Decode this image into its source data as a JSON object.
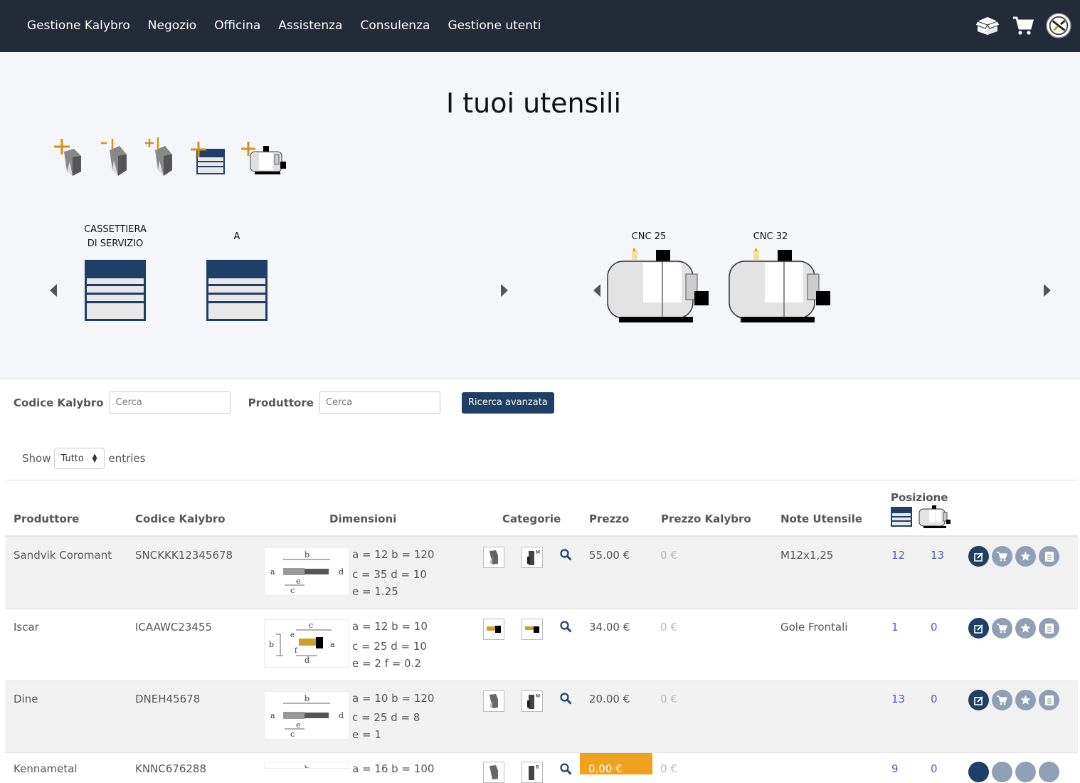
{
  "nav": {
    "links": [
      "Gestione Kalybro",
      "Negozio",
      "Officina",
      "Assistenza",
      "Consulenza",
      "Gestione utenti"
    ],
    "icons": [
      "open-box-icon",
      "cart-icon",
      "user-avatar-icon"
    ]
  },
  "page": {
    "title": "I tuoi utensili"
  },
  "tool_actions": [
    "add-tool-icon",
    "minus-one-tool-icon",
    "plus-one-tool-icon",
    "add-drawer-icon",
    "add-machine-icon"
  ],
  "stores": [
    {
      "label_line1": "CASSETTIERA",
      "label_line2": "DI SERVIZIO",
      "type": "drawer"
    },
    {
      "label_line1": "A",
      "label_line2": "",
      "type": "drawer"
    }
  ],
  "machines": [
    {
      "label": "CNC 25"
    },
    {
      "label": "CNC 32"
    }
  ],
  "filters": {
    "codice_label": "Codice Kalybro",
    "codice_placeholder": "Cerca",
    "produttore_label": "Produttore",
    "produttore_placeholder": "Cerca",
    "advanced_button": "Ricerca avanzata"
  },
  "entries": {
    "show": "Show",
    "value": "Tutto",
    "suffix": "entries"
  },
  "table": {
    "headers": {
      "produttore": "Produttore",
      "codice": "Codice Kalybro",
      "dimensioni": "Dimensioni",
      "categorie": "Categorie",
      "prezzo": "Prezzo",
      "prezzo_kalybro": "Prezzo Kalybro",
      "note": "Note Utensile",
      "posizione": "Posizione"
    },
    "rows": [
      {
        "produttore": "Sandvik Coromant",
        "codice": "SNCKKK12345678",
        "dim1": "a = 12 b = 120",
        "dim2": "c = 35 d = 10",
        "dim3": "e = 1.25",
        "prezzo": "55.00 €",
        "prezzo_k": "0 €",
        "note": "M12x1,25",
        "pos1": "12",
        "pos2": "13",
        "drawing": "drill",
        "cat": "drill"
      },
      {
        "produttore": "Iscar",
        "codice": "ICAAWC23455",
        "dim1": "a = 12 b = 10",
        "dim2": "c = 25 d = 10",
        "dim3": "e = 2 f = 0.2",
        "prezzo": "34.00 €",
        "prezzo_k": "0 €",
        "note": "Gole Frontali",
        "pos1": "1",
        "pos2": "0",
        "drawing": "groove",
        "cat": "groove"
      },
      {
        "produttore": "Dine",
        "codice": "DNEH45678",
        "dim1": "a = 10 b = 120",
        "dim2": "c = 25 d = 8",
        "dim3": "e = 1",
        "prezzo": "20.00 €",
        "prezzo_k": "0 €",
        "note": "",
        "pos1": "13",
        "pos2": "0",
        "drawing": "drill",
        "cat": "drill"
      },
      {
        "produttore": "Kennametal",
        "codice": "KNNC676288",
        "dim1": "a = 16 b = 100",
        "dim2": "",
        "dim3": "",
        "prezzo": "0.00 €",
        "prezzo_k": "0 €",
        "note": "",
        "pos1": "9",
        "pos2": "0",
        "drawing": "drill",
        "cat": "drill"
      }
    ]
  },
  "colors": {
    "navbar": "#232b38",
    "primary": "#1f3f66",
    "link": "#4a5fb6",
    "highlight": "#f0a21e"
  }
}
